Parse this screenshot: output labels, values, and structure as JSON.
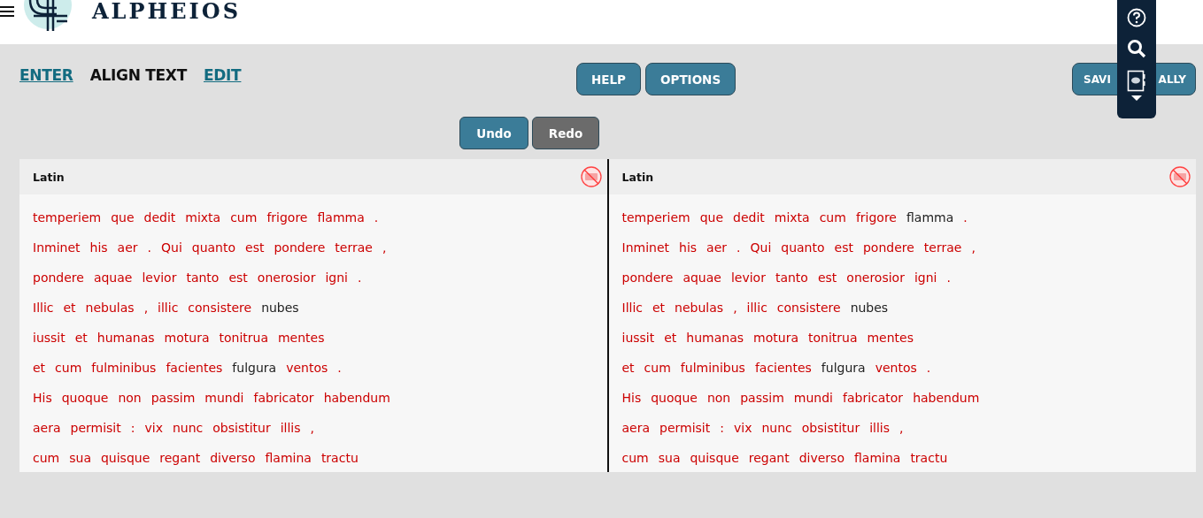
{
  "header": {
    "logo_text": "ALPHEIOS"
  },
  "nav": [
    {
      "label": "ENTER",
      "selected": false
    },
    {
      "label": "ALIGN TEXT",
      "selected": true
    },
    {
      "label": "EDIT",
      "selected": false
    }
  ],
  "buttons": [
    {
      "label": "HELP"
    },
    {
      "label": "OPTIONS"
    }
  ],
  "save_button": {
    "label_parts": [
      "SAVI",
      "ALLY"
    ]
  },
  "history": [
    {
      "label": "Undo",
      "disabled": false
    },
    {
      "label": "Redo",
      "disabled": true
    }
  ],
  "panels": [
    {
      "language": "Latin",
      "lines": [
        [
          {
            "t": "temperiem",
            "aligned": false
          },
          {
            "t": "que",
            "aligned": false
          },
          {
            "t": "dedit",
            "aligned": false
          },
          {
            "t": "mixta",
            "aligned": false
          },
          {
            "t": "cum",
            "aligned": false
          },
          {
            "t": "frigore",
            "aligned": false
          },
          {
            "t": "flamma",
            "aligned": false
          },
          {
            "t": ".",
            "aligned": false
          }
        ],
        [
          {
            "t": "Inminet",
            "aligned": false
          },
          {
            "t": "his",
            "aligned": false
          },
          {
            "t": "aer",
            "aligned": false
          },
          {
            "t": ".",
            "aligned": false
          },
          {
            "t": "Qui",
            "aligned": false
          },
          {
            "t": "quanto",
            "aligned": false
          },
          {
            "t": "est",
            "aligned": false
          },
          {
            "t": "pondere",
            "aligned": false
          },
          {
            "t": "terrae",
            "aligned": false
          },
          {
            "t": ",",
            "aligned": false
          }
        ],
        [
          {
            "t": "pondere",
            "aligned": false
          },
          {
            "t": "aquae",
            "aligned": false
          },
          {
            "t": "levior",
            "aligned": false
          },
          {
            "t": "tanto",
            "aligned": false
          },
          {
            "t": "est",
            "aligned": false
          },
          {
            "t": "onerosior",
            "aligned": false
          },
          {
            "t": "igni",
            "aligned": false
          },
          {
            "t": ".",
            "aligned": false
          }
        ],
        [
          {
            "t": "Illic",
            "aligned": false
          },
          {
            "t": "et",
            "aligned": false
          },
          {
            "t": "nebulas",
            "aligned": false
          },
          {
            "t": ",",
            "aligned": false
          },
          {
            "t": "illic",
            "aligned": false
          },
          {
            "t": "consistere",
            "aligned": false
          },
          {
            "t": "nubes",
            "aligned": true
          }
        ],
        [
          {
            "t": "iussit",
            "aligned": false
          },
          {
            "t": "et",
            "aligned": false
          },
          {
            "t": "humanas",
            "aligned": false
          },
          {
            "t": "motura",
            "aligned": false
          },
          {
            "t": "tonitrua",
            "aligned": false
          },
          {
            "t": "mentes",
            "aligned": false
          }
        ],
        [
          {
            "t": "et",
            "aligned": false
          },
          {
            "t": "cum",
            "aligned": false
          },
          {
            "t": "fulminibus",
            "aligned": false
          },
          {
            "t": "facientes",
            "aligned": false
          },
          {
            "t": "fulgura",
            "aligned": true
          },
          {
            "t": "ventos",
            "aligned": false
          },
          {
            "t": ".",
            "aligned": false
          }
        ],
        [
          {
            "t": "His",
            "aligned": false
          },
          {
            "t": "quoque",
            "aligned": false
          },
          {
            "t": "non",
            "aligned": false
          },
          {
            "t": "passim",
            "aligned": false
          },
          {
            "t": "mundi",
            "aligned": false
          },
          {
            "t": "fabricator",
            "aligned": false
          },
          {
            "t": "habendum",
            "aligned": false
          }
        ],
        [
          {
            "t": "aera",
            "aligned": false
          },
          {
            "t": "permisit",
            "aligned": false
          },
          {
            "t": ":",
            "aligned": false
          },
          {
            "t": "vix",
            "aligned": false
          },
          {
            "t": "nunc",
            "aligned": false
          },
          {
            "t": "obsistitur",
            "aligned": false
          },
          {
            "t": "illis",
            "aligned": false
          },
          {
            "t": ",",
            "aligned": false
          }
        ],
        [
          {
            "t": "cum",
            "aligned": false
          },
          {
            "t": "sua",
            "aligned": false
          },
          {
            "t": "quisque",
            "aligned": false
          },
          {
            "t": "regant",
            "aligned": false
          },
          {
            "t": "diverso",
            "aligned": false
          },
          {
            "t": "flamina",
            "aligned": false
          },
          {
            "t": "tractu",
            "aligned": false
          }
        ]
      ]
    },
    {
      "language": "Latin",
      "lines": [
        [
          {
            "t": "temperiem",
            "aligned": false
          },
          {
            "t": "que",
            "aligned": false
          },
          {
            "t": "dedit",
            "aligned": false
          },
          {
            "t": "mixta",
            "aligned": false
          },
          {
            "t": "cum",
            "aligned": false
          },
          {
            "t": "frigore",
            "aligned": false
          },
          {
            "t": "flamma",
            "aligned": true
          },
          {
            "t": ".",
            "aligned": false
          }
        ],
        [
          {
            "t": "Inminet",
            "aligned": false
          },
          {
            "t": "his",
            "aligned": false
          },
          {
            "t": "aer",
            "aligned": false
          },
          {
            "t": ".",
            "aligned": false
          },
          {
            "t": "Qui",
            "aligned": false
          },
          {
            "t": "quanto",
            "aligned": false
          },
          {
            "t": "est",
            "aligned": false
          },
          {
            "t": "pondere",
            "aligned": false
          },
          {
            "t": "terrae",
            "aligned": false
          },
          {
            "t": ",",
            "aligned": false
          }
        ],
        [
          {
            "t": "pondere",
            "aligned": false
          },
          {
            "t": "aquae",
            "aligned": false
          },
          {
            "t": "levior",
            "aligned": false
          },
          {
            "t": "tanto",
            "aligned": false
          },
          {
            "t": "est",
            "aligned": false
          },
          {
            "t": "onerosior",
            "aligned": false
          },
          {
            "t": "igni",
            "aligned": false
          },
          {
            "t": ".",
            "aligned": false
          }
        ],
        [
          {
            "t": "Illic",
            "aligned": false
          },
          {
            "t": "et",
            "aligned": false
          },
          {
            "t": "nebulas",
            "aligned": false
          },
          {
            "t": ",",
            "aligned": false
          },
          {
            "t": "illic",
            "aligned": false
          },
          {
            "t": "consistere",
            "aligned": false
          },
          {
            "t": "nubes",
            "aligned": true
          }
        ],
        [
          {
            "t": "iussit",
            "aligned": false
          },
          {
            "t": "et",
            "aligned": false
          },
          {
            "t": "humanas",
            "aligned": false
          },
          {
            "t": "motura",
            "aligned": false
          },
          {
            "t": "tonitrua",
            "aligned": false
          },
          {
            "t": "mentes",
            "aligned": false
          }
        ],
        [
          {
            "t": "et",
            "aligned": false
          },
          {
            "t": "cum",
            "aligned": false
          },
          {
            "t": "fulminibus",
            "aligned": false
          },
          {
            "t": "facientes",
            "aligned": false
          },
          {
            "t": "fulgura",
            "aligned": true
          },
          {
            "t": "ventos",
            "aligned": false
          },
          {
            "t": ".",
            "aligned": false
          }
        ],
        [
          {
            "t": "His",
            "aligned": false
          },
          {
            "t": "quoque",
            "aligned": false
          },
          {
            "t": "non",
            "aligned": false
          },
          {
            "t": "passim",
            "aligned": false
          },
          {
            "t": "mundi",
            "aligned": false
          },
          {
            "t": "fabricator",
            "aligned": false
          },
          {
            "t": "habendum",
            "aligned": false
          }
        ],
        [
          {
            "t": "aera",
            "aligned": false
          },
          {
            "t": "permisit",
            "aligned": false
          },
          {
            "t": ":",
            "aligned": false
          },
          {
            "t": "vix",
            "aligned": false
          },
          {
            "t": "nunc",
            "aligned": false
          },
          {
            "t": "obsistitur",
            "aligned": false
          },
          {
            "t": "illis",
            "aligned": false
          },
          {
            "t": ",",
            "aligned": false
          }
        ],
        [
          {
            "t": "cum",
            "aligned": false
          },
          {
            "t": "sua",
            "aligned": false
          },
          {
            "t": "quisque",
            "aligned": false
          },
          {
            "t": "regant",
            "aligned": false
          },
          {
            "t": "diverso",
            "aligned": false
          },
          {
            "t": "flamina",
            "aligned": false
          },
          {
            "t": "tractu",
            "aligned": false
          }
        ]
      ]
    }
  ]
}
